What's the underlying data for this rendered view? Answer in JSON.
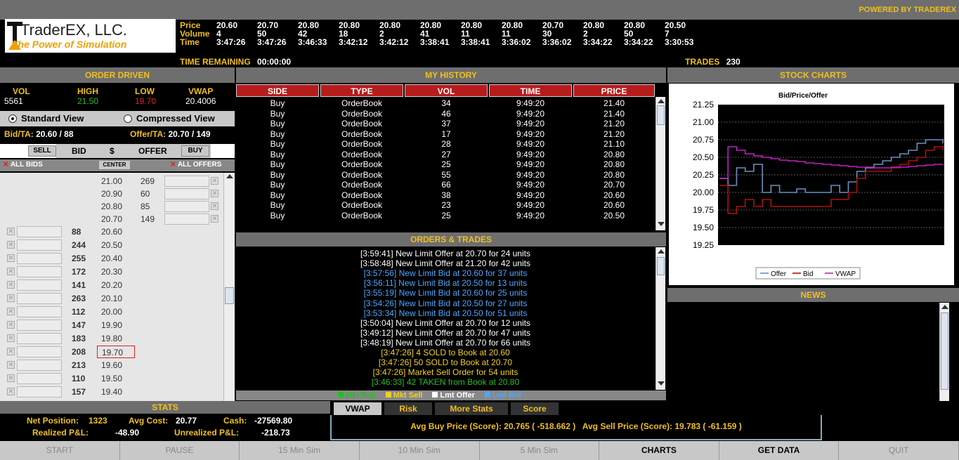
{
  "header": {
    "powered_by": "POWERED BY TRADEREX",
    "logo_name": "TraderEX, LLC.",
    "logo_tagline": "The Power of Simulation",
    "ticker_labels": [
      "Price",
      "Volume",
      "Time"
    ],
    "ticker": [
      {
        "price": "20.60",
        "volume": "4",
        "time": "3:47:26"
      },
      {
        "price": "20.70",
        "volume": "50",
        "time": "3:47:26"
      },
      {
        "price": "20.80",
        "volume": "42",
        "time": "3:46:33"
      },
      {
        "price": "20.80",
        "volume": "18",
        "time": "3:42:12"
      },
      {
        "price": "20.80",
        "volume": "2",
        "time": "3:42:12"
      },
      {
        "price": "20.80",
        "volume": "41",
        "time": "3:38:41"
      },
      {
        "price": "20.80",
        "volume": "11",
        "time": "3:38:41"
      },
      {
        "price": "20.80",
        "volume": "11",
        "time": "3:36:02"
      },
      {
        "price": "20.70",
        "volume": "30",
        "time": "3:36:02"
      },
      {
        "price": "20.80",
        "volume": "2",
        "time": "3:34:22"
      },
      {
        "price": "20.80",
        "volume": "50",
        "time": "3:34:22"
      },
      {
        "price": "20.50",
        "volume": "7",
        "time": "3:30:53"
      }
    ],
    "time_remaining_label": "TIME REMAINING",
    "time_remaining_value": "00:00:00",
    "trades_label": "TRADES",
    "trades_value": "230"
  },
  "order_driven": {
    "title": "ORDER DRIVEN",
    "vol_label": "VOL",
    "vol_value": "5561",
    "high_label": "HIGH",
    "high_value": "21.50",
    "low_label": "LOW",
    "low_value": "19.70",
    "vwap_label": "VWAP",
    "vwap_value": "20.4006",
    "standard_view": "Standard View",
    "compressed_view": "Compressed View",
    "bid_ta_label": "Bid/TA:",
    "bid_ta_value": "20.60 / 88",
    "offer_ta_label": "Offer/TA:",
    "offer_ta_value": "20.70 / 149",
    "sell_label": "SELL",
    "bid_label": "BID",
    "dollar_label": "$",
    "offer_label": "OFFER",
    "buy_label": "BUY",
    "all_bids": "ALL BIDS",
    "center": "CENTER",
    "all_offers": "ALL OFFERS",
    "offers": [
      {
        "price": "21.00",
        "size": "269"
      },
      {
        "price": "20.90",
        "size": "60"
      },
      {
        "price": "20.80",
        "size": "85"
      },
      {
        "price": "20.70",
        "size": "149"
      }
    ],
    "bids": [
      {
        "size": "88",
        "price": "20.60"
      },
      {
        "size": "244",
        "price": "20.50"
      },
      {
        "size": "255",
        "price": "20.40"
      },
      {
        "size": "172",
        "price": "20.30"
      },
      {
        "size": "141",
        "price": "20.20"
      },
      {
        "size": "263",
        "price": "20.10"
      },
      {
        "size": "112",
        "price": "20.00"
      },
      {
        "size": "147",
        "price": "19.90"
      },
      {
        "size": "183",
        "price": "19.80"
      },
      {
        "size": "208",
        "price": "19.70"
      },
      {
        "size": "213",
        "price": "19.60"
      },
      {
        "size": "110",
        "price": "19.50"
      },
      {
        "size": "157",
        "price": "19.40"
      }
    ],
    "highlighted_bid_price": "19.70"
  },
  "my_history": {
    "title": "MY HISTORY",
    "columns": [
      "SIDE",
      "TYPE",
      "VOL",
      "TIME",
      "PRICE"
    ],
    "rows": [
      [
        "Buy",
        "OrderBook",
        "34",
        "9:49:20",
        "21.40"
      ],
      [
        "Buy",
        "OrderBook",
        "46",
        "9:49:20",
        "21.40"
      ],
      [
        "Buy",
        "OrderBook",
        "37",
        "9:49:20",
        "21.20"
      ],
      [
        "Buy",
        "OrderBook",
        "17",
        "9:49:20",
        "21.20"
      ],
      [
        "Buy",
        "OrderBook",
        "28",
        "9:49:20",
        "21.10"
      ],
      [
        "Buy",
        "OrderBook",
        "27",
        "9:49:20",
        "20.80"
      ],
      [
        "Buy",
        "OrderBook",
        "25",
        "9:49:20",
        "20.80"
      ],
      [
        "Buy",
        "OrderBook",
        "55",
        "9:49:20",
        "20.80"
      ],
      [
        "Buy",
        "OrderBook",
        "66",
        "9:49:20",
        "20.70"
      ],
      [
        "Buy",
        "OrderBook",
        "38",
        "9:49:20",
        "20.60"
      ],
      [
        "Buy",
        "OrderBook",
        "23",
        "9:49:20",
        "20.60"
      ],
      [
        "Buy",
        "OrderBook",
        "25",
        "9:49:20",
        "20.50"
      ]
    ]
  },
  "orders_trades": {
    "title": "ORDERS & TRADES",
    "lines": [
      {
        "text": "[3:59:41] New Limit Offer at 20.70 for 24 units",
        "kind": "offer"
      },
      {
        "text": "[3:58:48] New Limit Offer at 21.20 for 42 units",
        "kind": "offer"
      },
      {
        "text": "[3:57:56] New Limit Bid at 20.60 for 37 units",
        "kind": "bid"
      },
      {
        "text": "[3:56:11] New Limit Bid at 20.50 for 13 units",
        "kind": "bid"
      },
      {
        "text": "[3:55:19] New Limit Bid at 20.60 for 25 units",
        "kind": "bid"
      },
      {
        "text": "[3:54:26] New Limit Bid at 20.50 for 27 units",
        "kind": "bid"
      },
      {
        "text": "[3:53:34] New Limit Bid at 20.50 for 51 units",
        "kind": "bid"
      },
      {
        "text": "[3:50:04] New Limit Offer at 20.70 for 12 units",
        "kind": "offer"
      },
      {
        "text": "[3:49:12] New Limit Offer at 20.70 for 47 units",
        "kind": "offer"
      },
      {
        "text": "[3:48:19] New Limit Offer at 20.70 for 66 units",
        "kind": "offer"
      },
      {
        "text": "[3:47:26] 4 SOLD to Book at 20.60",
        "kind": "sell"
      },
      {
        "text": "[3:47:26] 50 SOLD to Book at 20.70",
        "kind": "sell"
      },
      {
        "text": "[3:47:26] Market Sell Order for 54 units",
        "kind": "sell"
      },
      {
        "text": "[3:46:33] 42 TAKEN from Book at 20.80",
        "kind": "buy"
      }
    ],
    "legend": [
      {
        "label": "Mkt Buy",
        "color": "#22c022"
      },
      {
        "label": "Mkt Sell",
        "color": "#f0d020"
      },
      {
        "label": "Lmt Offer",
        "color": "#ffffff"
      },
      {
        "label": "Lmt Bid",
        "color": "#4aa8ff"
      }
    ]
  },
  "stock_charts": {
    "title": "STOCK CHARTS",
    "chart_data": {
      "type": "line",
      "title": "Bid/Price/Offer",
      "ylim": [
        19.25,
        21.25
      ],
      "yticks": [
        "21.25",
        "21.00",
        "20.75",
        "20.50",
        "20.25",
        "20.00",
        "19.75",
        "19.50",
        "19.25"
      ],
      "grid": true,
      "legend_position": "bottom",
      "series": [
        {
          "name": "Offer",
          "color": "#6a8fc0",
          "values": [
            20.2,
            20.1,
            20.35,
            20.3,
            20.4,
            20.0,
            20.1,
            20.0,
            20.0,
            20.05,
            20.0,
            20.0,
            20.0,
            20.1,
            20.0,
            20.15,
            20.3,
            20.35,
            20.4,
            20.45,
            20.5,
            20.55,
            20.6,
            20.7,
            20.75,
            20.75,
            20.7
          ]
        },
        {
          "name": "Bid",
          "color": "#b01010",
          "values": [
            20.1,
            19.7,
            19.8,
            19.9,
            19.8,
            19.9,
            19.8,
            19.8,
            19.8,
            19.8,
            19.8,
            19.8,
            19.8,
            19.9,
            19.9,
            20.0,
            20.2,
            20.3,
            20.3,
            20.3,
            20.35,
            20.4,
            20.45,
            20.5,
            20.6,
            20.65,
            20.6
          ]
        },
        {
          "name": "VWAP",
          "color": "#c020c0",
          "values": [
            20.2,
            20.65,
            20.6,
            20.55,
            20.52,
            20.5,
            20.48,
            20.46,
            20.45,
            20.44,
            20.42,
            20.41,
            20.4,
            20.39,
            20.38,
            20.37,
            20.36,
            20.36,
            20.35,
            20.35,
            20.36,
            20.36,
            20.37,
            20.38,
            20.39,
            20.4,
            20.4
          ]
        }
      ]
    }
  },
  "news": {
    "title": "NEWS"
  },
  "stats": {
    "title": "STATS",
    "net_position_label": "Net Position:",
    "net_position_value": "1323",
    "avg_cost_label": "Avg Cost:",
    "avg_cost_value": "20.77",
    "cash_label": "Cash:",
    "cash_value": "-27569.80",
    "realized_label": "Realized P&L:",
    "realized_value": "-48.90",
    "unrealized_label": "Unrealized P&L:",
    "unrealized_value": "-218.73",
    "tabs": [
      "VWAP",
      "Risk",
      "More Stats",
      "Score"
    ],
    "vwap_summary": "Avg Buy Price (Score): 20.765 ( -518.662 )   Avg Sell Price (Score): 19.783 ( -61.159 )"
  },
  "bottom_buttons": [
    "START",
    "PAUSE",
    "15 Min Sim",
    "10 Min Sim",
    "5 Min Sim",
    "CHARTS",
    "GET DATA",
    "QUIT"
  ]
}
